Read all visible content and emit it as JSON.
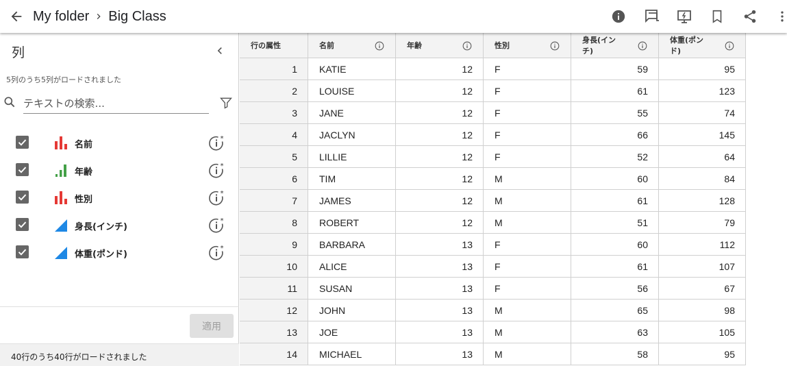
{
  "breadcrumb": {
    "folder": "My folder",
    "current": "Big Class"
  },
  "toolbar": {
    "icons": [
      "info-icon",
      "comment-icon",
      "presentation-icon",
      "bookmark-icon",
      "share-icon",
      "more-vert-icon"
    ]
  },
  "panel": {
    "title": "列",
    "loaded_columns": "5列のうち5列がロードされました",
    "search_placeholder": "テキストの検索...",
    "apply_label": "適用",
    "status": "40行のうち40行がロードされました",
    "columns": [
      {
        "name": "名前",
        "type": "nominal",
        "checked": true
      },
      {
        "name": "年齢",
        "type": "ordinal",
        "checked": true
      },
      {
        "name": "性別",
        "type": "nominal",
        "checked": true
      },
      {
        "name": "身長(インチ)",
        "type": "continuous",
        "checked": true
      },
      {
        "name": "体重(ポンド)",
        "type": "continuous",
        "checked": true
      }
    ],
    "colors": {
      "nominal": "#e53935",
      "ordinal": "#43a047",
      "continuous": "#1e88e5"
    }
  },
  "table": {
    "headers": [
      "行の属性",
      "名前",
      "年齢",
      "性別",
      "身長(インチ)",
      "体重(ポンド)"
    ],
    "rows": [
      [
        "1",
        "KATIE",
        "12",
        "F",
        "59",
        "95"
      ],
      [
        "2",
        "LOUISE",
        "12",
        "F",
        "61",
        "123"
      ],
      [
        "3",
        "JANE",
        "12",
        "F",
        "55",
        "74"
      ],
      [
        "4",
        "JACLYN",
        "12",
        "F",
        "66",
        "145"
      ],
      [
        "5",
        "LILLIE",
        "12",
        "F",
        "52",
        "64"
      ],
      [
        "6",
        "TIM",
        "12",
        "M",
        "60",
        "84"
      ],
      [
        "7",
        "JAMES",
        "12",
        "M",
        "61",
        "128"
      ],
      [
        "8",
        "ROBERT",
        "12",
        "M",
        "51",
        "79"
      ],
      [
        "9",
        "BARBARA",
        "13",
        "F",
        "60",
        "112"
      ],
      [
        "10",
        "ALICE",
        "13",
        "F",
        "61",
        "107"
      ],
      [
        "11",
        "SUSAN",
        "13",
        "F",
        "56",
        "67"
      ],
      [
        "12",
        "JOHN",
        "13",
        "M",
        "65",
        "98"
      ],
      [
        "13",
        "JOE",
        "13",
        "M",
        "63",
        "105"
      ],
      [
        "14",
        "MICHAEL",
        "13",
        "M",
        "58",
        "95"
      ]
    ]
  }
}
